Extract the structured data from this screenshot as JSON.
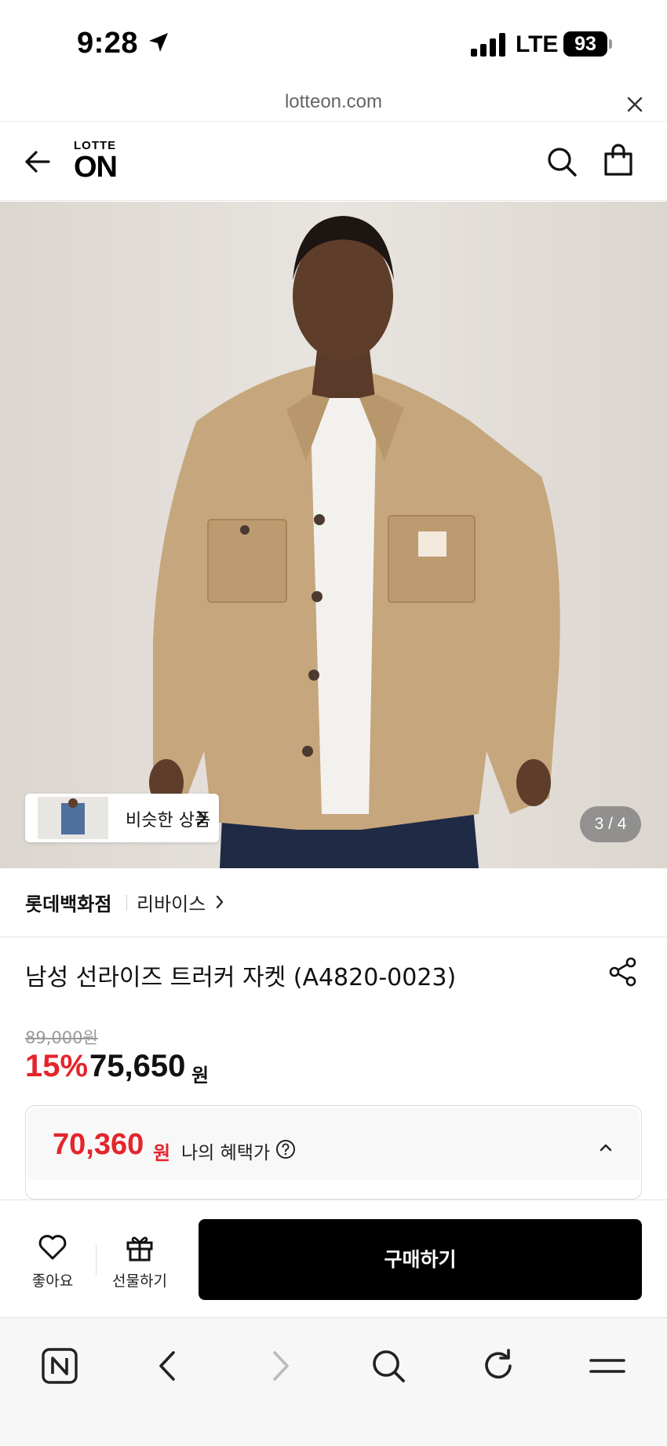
{
  "status_bar": {
    "time": "9:28",
    "network": "LTE",
    "battery": "93"
  },
  "url_bar": {
    "url": "lotteon.com"
  },
  "header": {
    "logo_top": "LOTTE",
    "logo_bottom": "ON"
  },
  "gallery": {
    "similar_products_label": "비슷한 상품",
    "counter": "3 / 4"
  },
  "store": {
    "name": "롯데백화점",
    "brand": "리바이스"
  },
  "product": {
    "title": "남성 선라이즈 트러커 자켓 (A4820-0023)",
    "original_price": "89,000원",
    "discount": "15%",
    "sale_price": "75,650",
    "sale_unit": "원"
  },
  "benefit": {
    "price": "70,360",
    "unit": "원",
    "label": "나의 혜택가"
  },
  "actions": {
    "like_label": "좋아요",
    "gift_label": "선물하기",
    "buy_label": "구매하기"
  },
  "colors": {
    "accent_red": "#e5242b",
    "buy_button": "#000000"
  },
  "icons": [
    "location-arrow-icon",
    "signal-icon",
    "battery-icon",
    "close-icon",
    "back-arrow-icon",
    "search-icon",
    "shopping-bag-icon",
    "chevron-right-icon",
    "share-icon",
    "help-circle-icon",
    "chevron-up-icon",
    "heart-icon",
    "gift-icon",
    "naver-icon",
    "reload-icon",
    "menu-icon"
  ]
}
